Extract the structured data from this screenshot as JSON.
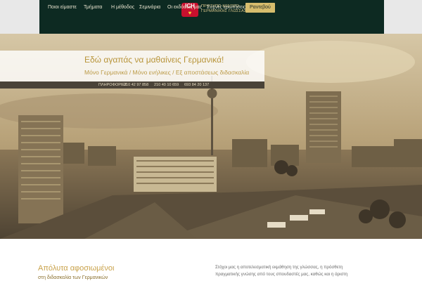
{
  "header": {
    "logo": {
      "badge_text": "ICH",
      "heart": "♥",
      "lines": [
        "ΠΡΟΤΥΠΟ ΚΕΝΤΡΟ",
        "ΓΕΡΜΑΝΙΚΗΣ ΓΛΩΣΣΑΣ"
      ]
    },
    "nav": [
      "Ποιοι είμαστε",
      "Τμήματα",
      "Η μέθοδος",
      "Σεμινάρια",
      "Οι εκδόσεις μας",
      "Συχνές ερωτήσεις",
      "Ραντεβού"
    ]
  },
  "hero": {
    "title": "Εδώ αγαπάς να μαθαίνεις Γερμανικά!",
    "subtitle": "Μόνο Γερμανικά / Μόνο ενήλικες / Εξ αποστάσεως διδασκαλία",
    "info_label": "ΠΛΗΡΟΦΟΡΙΕΣ",
    "phones": [
      "210 42 97 858",
      "210 40 10 659",
      "693 84 20 137"
    ]
  },
  "about": {
    "title": "Απόλυτα αφοσιωμένοι",
    "subtitle": "στη διδασκαλία των Γερμανικών",
    "body_lines": [
      "Στόχοι μας η αποτελεσματική εκμάθηση της γλώσσας, η πρόσθετη",
      "πραγματικής γνώσης από τους σπουδαστές μας, καθώς και η άριστη"
    ]
  },
  "colors": {
    "nav_bg": "#0d2a22",
    "accent_gold": "#c9a24b",
    "cta_bg": "#d6bd6d"
  }
}
